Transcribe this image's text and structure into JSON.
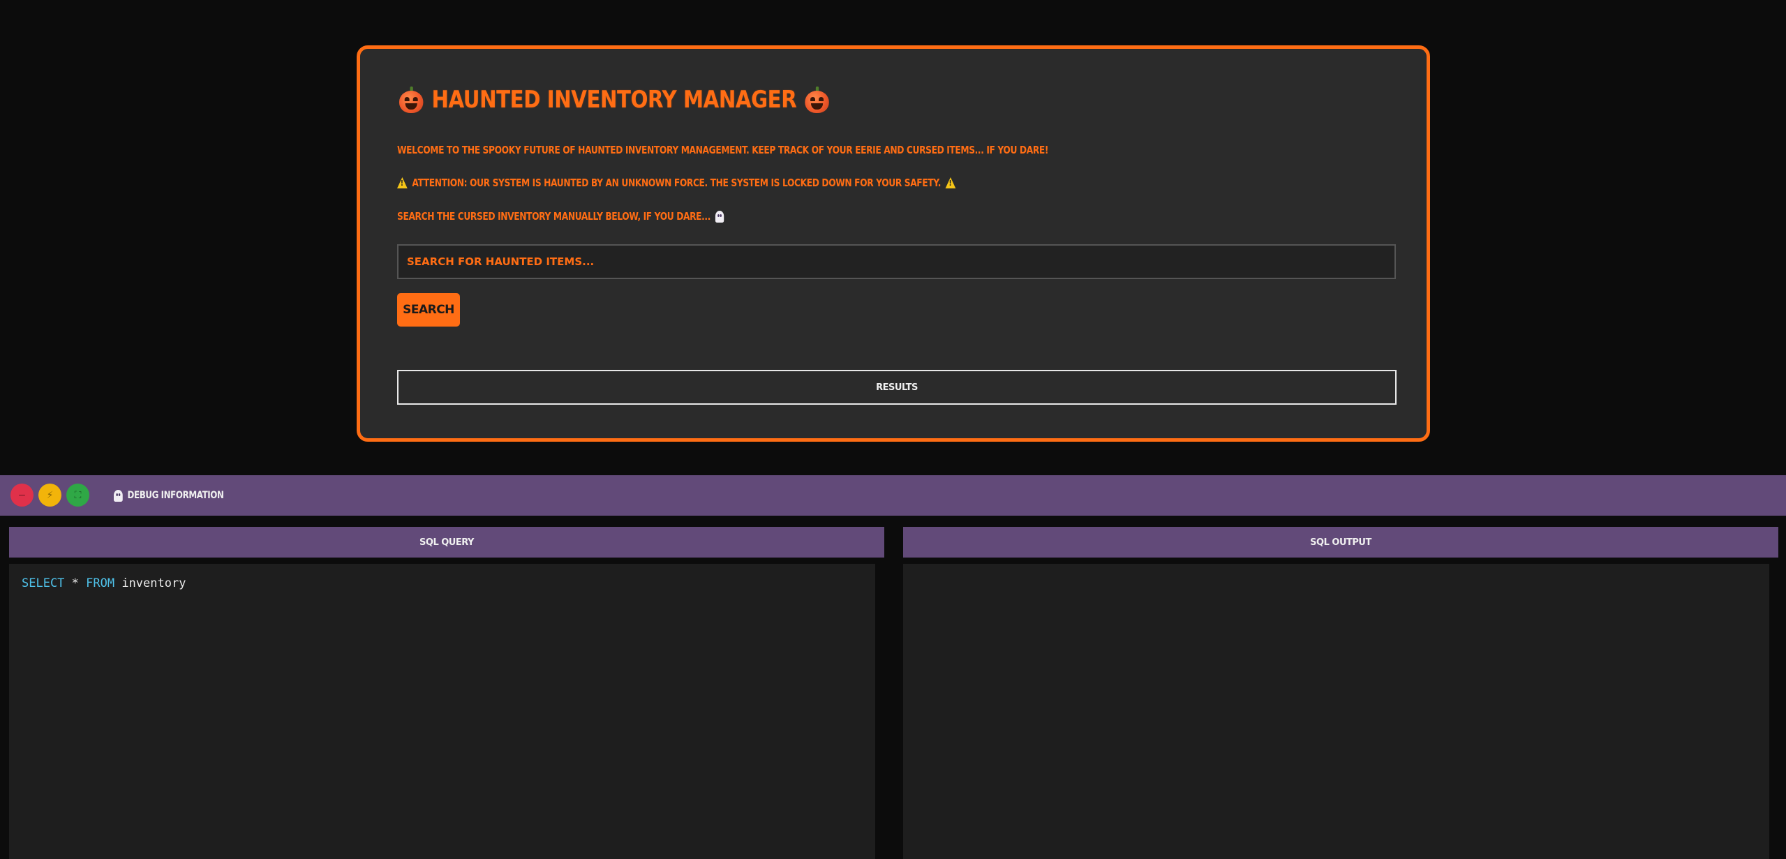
{
  "app": {
    "title": "Haunted Inventory Manager",
    "welcome": "Welcome to the spooky future of haunted inventory management. Keep track of your eerie and cursed items... if you dare!",
    "warning": "Attention: Our system is haunted by an unknown force. The system is locked down for your safety.",
    "search_prompt": "Search the cursed inventory manually below, if you dare...",
    "search": {
      "placeholder": "Search for haunted items...",
      "value": "",
      "button_label": "Search"
    },
    "results_label": "Results"
  },
  "debug": {
    "title": "Debug Information",
    "window_controls": {
      "close": "−",
      "minimize": "⚡",
      "maximize": "⛶"
    },
    "sql_query": {
      "header": "SQL Query",
      "code": {
        "kw1": "SELECT",
        "mid": " * ",
        "kw2": "FROM",
        "table": " inventory"
      }
    },
    "sql_output": {
      "header": "SQL Output",
      "content": ""
    }
  },
  "icons": {
    "title_left": "pumpkin-icon",
    "title_right": "pumpkin-icon",
    "warning": "warning-icon",
    "prompt": "ghost-icon",
    "debug": "ghost-icon"
  },
  "colors": {
    "accent": "#ff6d14",
    "card_bg": "#2b2b2b",
    "page_bg": "#0c0c0c",
    "debug_purple": "#624a79",
    "code_keyword": "#4fc1e9"
  }
}
